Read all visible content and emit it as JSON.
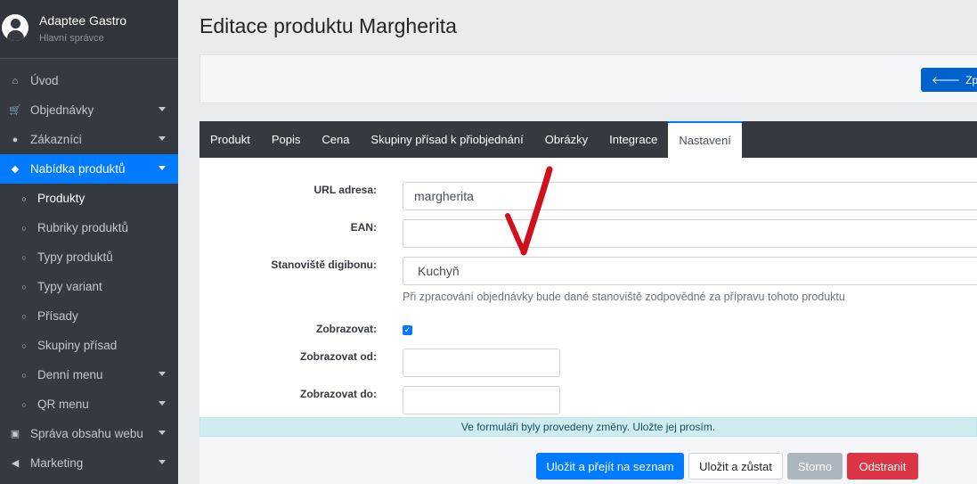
{
  "brand": {
    "name": "Adaptee Gastro",
    "role": "Hlavní správce"
  },
  "sidebar": {
    "items": [
      {
        "label": "Úvod",
        "icon": "home-icon",
        "glyph": "⌂",
        "caret": false
      },
      {
        "label": "Objednávky",
        "icon": "cart-icon",
        "glyph": "🛒",
        "caret": true
      },
      {
        "label": "Zákazníci",
        "icon": "user-icon",
        "glyph": "●",
        "caret": true
      },
      {
        "label": "Nabídka produktů",
        "icon": "tag-icon",
        "glyph": "◆",
        "caret": true,
        "active": true
      },
      {
        "label": "Produkty",
        "icon": "circle-icon",
        "glyph": "○",
        "sub": true,
        "current": true
      },
      {
        "label": "Rubriky produktů",
        "icon": "circle-icon",
        "glyph": "○",
        "sub": true
      },
      {
        "label": "Typy produktů",
        "icon": "circle-icon",
        "glyph": "○",
        "sub": true
      },
      {
        "label": "Typy variant",
        "icon": "circle-icon",
        "glyph": "○",
        "sub": true
      },
      {
        "label": "Přísady",
        "icon": "circle-icon",
        "glyph": "○",
        "sub": true
      },
      {
        "label": "Skupiny přísad",
        "icon": "circle-icon",
        "glyph": "○",
        "sub": true
      },
      {
        "label": "Denní menu",
        "icon": "circle-icon",
        "glyph": "○",
        "sub": true,
        "caret": true
      },
      {
        "label": "QR menu",
        "icon": "circle-icon",
        "glyph": "○",
        "sub": true,
        "caret": true
      },
      {
        "label": "Správa obsahu webu",
        "icon": "sitemap-icon",
        "glyph": "▣",
        "caret": true
      },
      {
        "label": "Marketing",
        "icon": "bullhorn-icon",
        "glyph": "◀",
        "caret": true
      }
    ]
  },
  "page": {
    "title": "Editace produktu Margherita"
  },
  "toolbar": {
    "back_label": "Zpět d"
  },
  "tabs": [
    {
      "label": "Produkt"
    },
    {
      "label": "Popis"
    },
    {
      "label": "Cena"
    },
    {
      "label": "Skupiny přísad k přiobjednání"
    },
    {
      "label": "Obrázky"
    },
    {
      "label": "Integrace"
    },
    {
      "label": "Nastavení",
      "active": true
    }
  ],
  "form": {
    "url_label": "URL adresa:",
    "url_value": "margherita",
    "ean_label": "EAN:",
    "ean_value": "",
    "station_label": "Stanoviště digibonu:",
    "station_value": "Kuchyň",
    "station_help": "Při zpracování objednávky bude dané stanoviště zodpovědné za přípravu tohoto produktu",
    "visible_label": "Zobrazovat:",
    "visible_checked": true,
    "from_label": "Zobrazovat od:",
    "from_value": "",
    "to_label": "Zobrazovat do:",
    "to_value": ""
  },
  "alert": {
    "text": "Ve formuláři byly provedeny změny. Uložte jej prosím."
  },
  "actions": {
    "save_list": "Uložit a přejít na seznam",
    "save_stay": "Uložit a zůstat",
    "cancel": "Storno",
    "delete": "Odstranit"
  },
  "colors": {
    "primary": "#007bff",
    "sidebar": "#343a40",
    "danger": "#dc3545",
    "annotation": "#d0111b"
  }
}
